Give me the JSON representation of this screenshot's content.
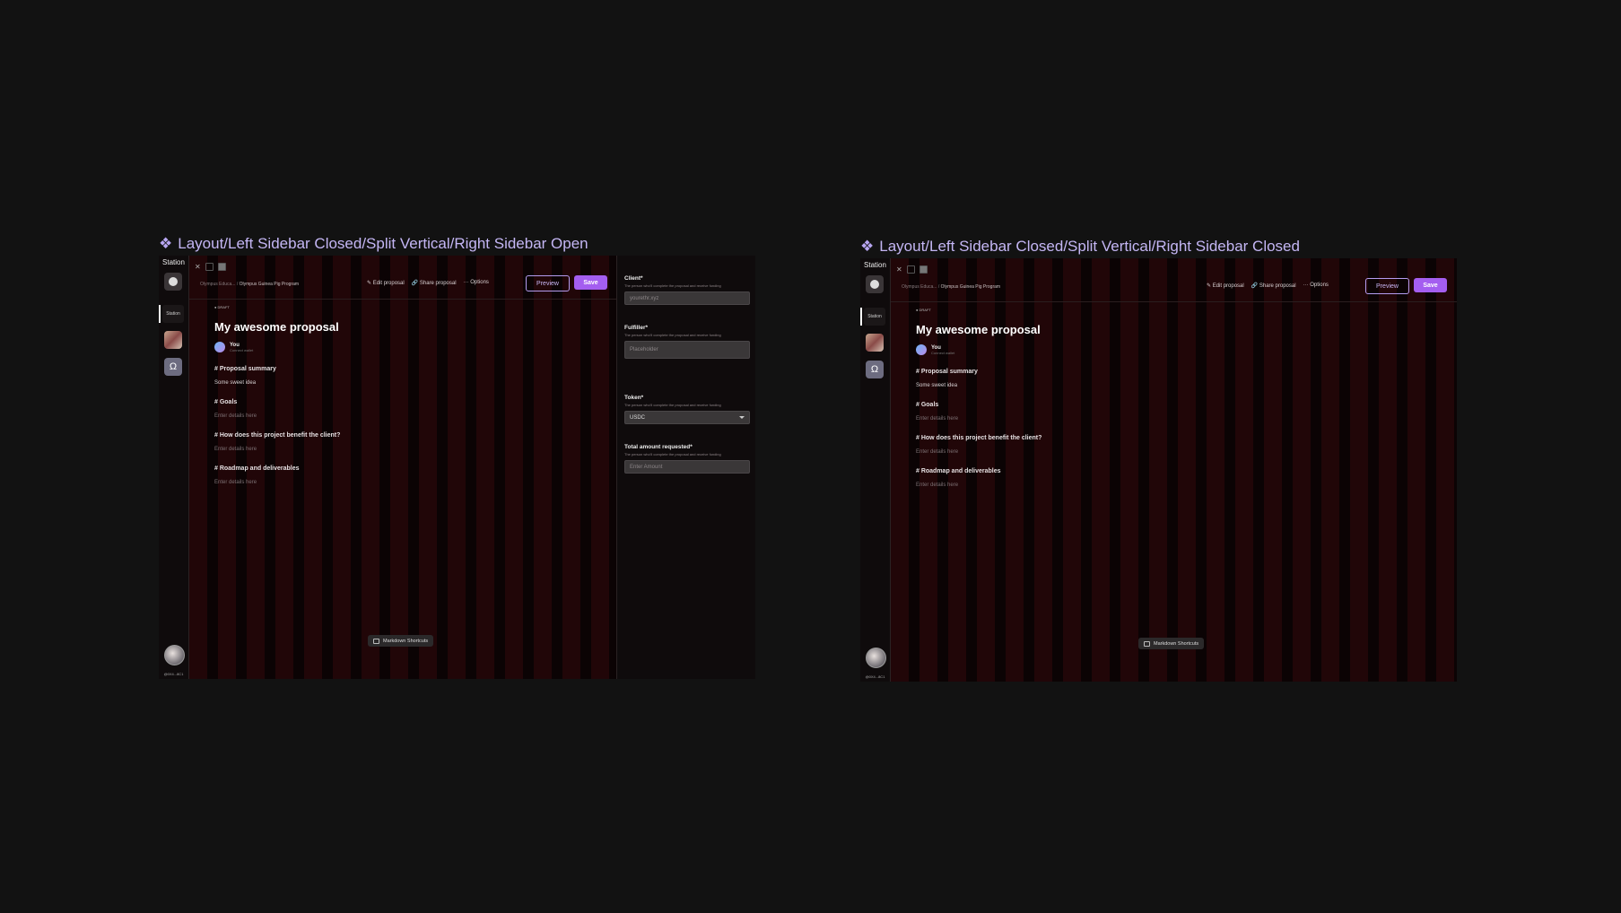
{
  "frames": [
    {
      "title": "Layout/Left Sidebar Closed/Split Vertical/Right Sidebar Open",
      "sidebar": {
        "brand": "Station",
        "station_tile": "Station",
        "handle": "@0X4...8C1"
      },
      "breadcrumb": {
        "parent": "Olympus Educa...",
        "separator": "/",
        "current": "Olympus Guinea Pig Program"
      },
      "actions": {
        "edit": "Edit proposal",
        "share": "Share proposal",
        "options": "Options"
      },
      "buttons": {
        "preview": "Preview",
        "save": "Save"
      },
      "doc": {
        "status": "● DRAFT",
        "title": "My awesome proposal",
        "author": "You",
        "author_sub": "Connect wallet",
        "sections": [
          {
            "heading": "# Proposal summary",
            "body": "Some sweet idea"
          },
          {
            "heading": "# Goals",
            "body": "Enter details here"
          },
          {
            "heading": "# How does this project benefit the client?",
            "body": "Enter details here"
          },
          {
            "heading": "# Roadmap and deliverables",
            "body": "Enter details here"
          }
        ]
      },
      "markdown_shortcuts": "Markdown Shortcuts",
      "right_sidebar": {
        "fields": [
          {
            "label": "Client*",
            "hint": "The person who'll complete the proposal and receive funding",
            "placeholder": "yourethr.xyz"
          },
          {
            "label": "Fulfiller*",
            "hint": "The person who'll complete the proposal and receive funding",
            "placeholder": "Placeholder"
          },
          {
            "label": "Token*",
            "hint": "The person who'll complete the proposal and receive funding",
            "value": "USDC"
          },
          {
            "label": "Total amount requested*",
            "hint": "The person who'll complete the proposal and receive funding",
            "placeholder": "Enter Amount"
          }
        ]
      }
    },
    {
      "title": "Layout/Left Sidebar Closed/Split Vertical/Right Sidebar Closed",
      "sidebar": {
        "brand": "Station",
        "station_tile": "Station",
        "handle": "@0X4...8C1"
      },
      "breadcrumb": {
        "parent": "Olympus Educa...",
        "separator": "/",
        "current": "Olympus Guinea Pig Program"
      },
      "actions": {
        "edit": "Edit proposal",
        "share": "Share proposal",
        "options": "Options"
      },
      "buttons": {
        "preview": "Preview",
        "save": "Save"
      },
      "doc": {
        "status": "● DRAFT",
        "title": "My awesome proposal",
        "author": "You",
        "author_sub": "Connect wallet",
        "sections": [
          {
            "heading": "# Proposal summary",
            "body": "Some sweet idea"
          },
          {
            "heading": "# Goals",
            "body": "Enter details here"
          },
          {
            "heading": "# How does this project benefit the client?",
            "body": "Enter details here"
          },
          {
            "heading": "# Roadmap and deliverables",
            "body": "Enter details here"
          }
        ]
      },
      "markdown_shortcuts": "Markdown Shortcuts"
    }
  ],
  "colors": {
    "page_bg": "#121212",
    "accent": "#a45ef0",
    "title": "#c4b6f4"
  }
}
